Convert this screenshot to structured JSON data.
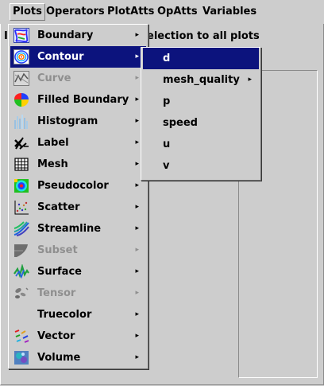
{
  "menubar": {
    "items": [
      {
        "label": "Plots"
      },
      {
        "label": "Operators"
      },
      {
        "label": "PlotAtts"
      },
      {
        "label": "OpAtts"
      },
      {
        "label": "Variables"
      }
    ]
  },
  "background": {
    "left_fragment": "I",
    "right_text": "election to all plots"
  },
  "plots_menu": {
    "items": [
      {
        "label": "Boundary",
        "icon": "boundary-icon",
        "enabled": true
      },
      {
        "label": "Contour",
        "icon": "contour-icon",
        "enabled": true,
        "selected": true
      },
      {
        "label": "Curve",
        "icon": "curve-icon",
        "enabled": false
      },
      {
        "label": "Filled Boundary",
        "icon": "filled-boundary-icon",
        "enabled": true
      },
      {
        "label": "Histogram",
        "icon": "histogram-icon",
        "enabled": true
      },
      {
        "label": "Label",
        "icon": "label-icon",
        "enabled": true
      },
      {
        "label": "Mesh",
        "icon": "mesh-icon",
        "enabled": true
      },
      {
        "label": "Pseudocolor",
        "icon": "pseudocolor-icon",
        "enabled": true
      },
      {
        "label": "Scatter",
        "icon": "scatter-icon",
        "enabled": true
      },
      {
        "label": "Streamline",
        "icon": "streamline-icon",
        "enabled": true
      },
      {
        "label": "Subset",
        "icon": "subset-icon",
        "enabled": false
      },
      {
        "label": "Surface",
        "icon": "surface-icon",
        "enabled": true
      },
      {
        "label": "Tensor",
        "icon": "tensor-icon",
        "enabled": false
      },
      {
        "label": "Truecolor",
        "icon": "",
        "enabled": true
      },
      {
        "label": "Vector",
        "icon": "vector-icon",
        "enabled": true
      },
      {
        "label": "Volume",
        "icon": "volume-icon",
        "enabled": true
      }
    ],
    "submenu_arrow": "▸"
  },
  "contour_submenu": {
    "items": [
      {
        "label": "d",
        "selected": true
      },
      {
        "label": "mesh_quality",
        "has_submenu": true
      },
      {
        "label": "p"
      },
      {
        "label": "speed"
      },
      {
        "label": "u"
      },
      {
        "label": "v"
      }
    ]
  },
  "colors": {
    "background": "#cdcdcd",
    "selection": "#0c137d",
    "disabled_text": "#8f8f8f"
  }
}
